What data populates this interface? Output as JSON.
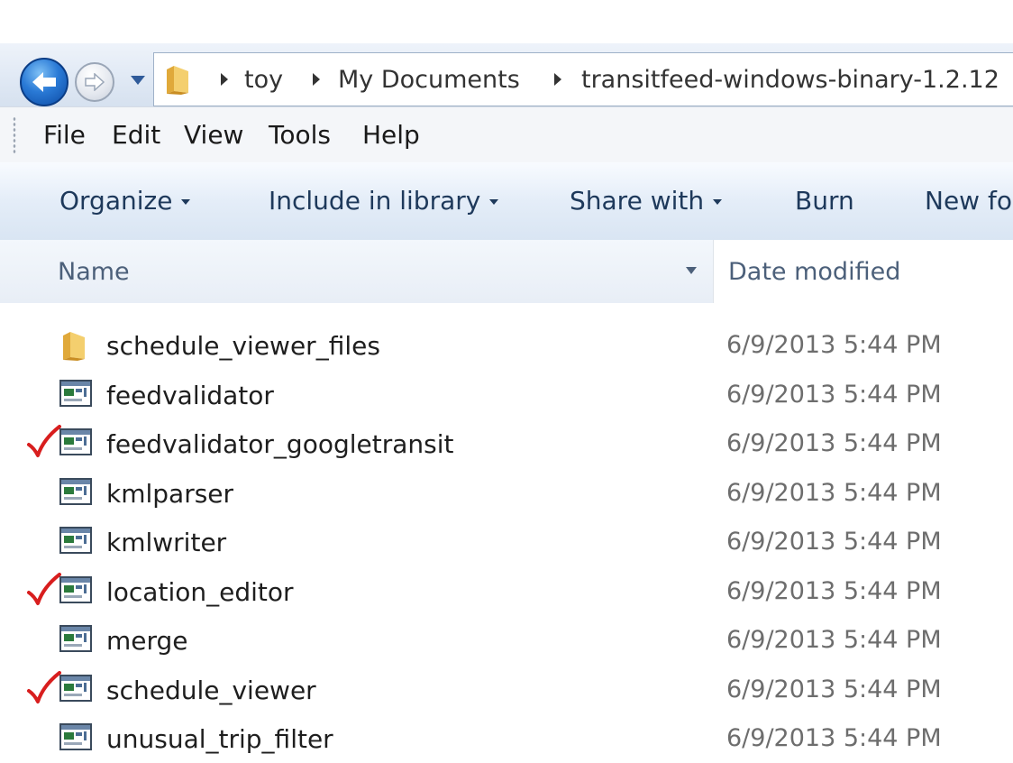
{
  "window": {
    "breadcrumb": [
      "toy",
      "My Documents",
      "transitfeed-windows-binary-1.2.12"
    ]
  },
  "menu": [
    "File",
    "Edit",
    "View",
    "Tools",
    "Help"
  ],
  "toolbar": {
    "organize": "Organize",
    "include_in_library": "Include in library",
    "share_with": "Share with",
    "burn": "Burn",
    "new_folder": "New fo"
  },
  "columns": {
    "name": "Name",
    "date_modified": "Date modified"
  },
  "files": [
    {
      "name": "schedule_viewer_files",
      "date": "6/9/2013 5:44 PM",
      "type": "folder",
      "checked": false
    },
    {
      "name": "feedvalidator",
      "date": "6/9/2013 5:44 PM",
      "type": "app",
      "checked": false
    },
    {
      "name": "feedvalidator_googletransit",
      "date": "6/9/2013 5:44 PM",
      "type": "app",
      "checked": true
    },
    {
      "name": "kmlparser",
      "date": "6/9/2013 5:44 PM",
      "type": "app",
      "checked": false
    },
    {
      "name": "kmlwriter",
      "date": "6/9/2013 5:44 PM",
      "type": "app",
      "checked": false
    },
    {
      "name": "location_editor",
      "date": "6/9/2013 5:44 PM",
      "type": "app",
      "checked": true
    },
    {
      "name": "merge",
      "date": "6/9/2013 5:44 PM",
      "type": "app",
      "checked": false
    },
    {
      "name": "schedule_viewer",
      "date": "6/9/2013 5:44 PM",
      "type": "app",
      "checked": true
    },
    {
      "name": "unusual_trip_filter",
      "date": "6/9/2013 5:44 PM",
      "type": "app",
      "checked": false
    }
  ],
  "colors": {
    "check_mark": "#d81e1e",
    "toolbar_text": "#1e395b",
    "header_text": "#4c607a",
    "date_text": "#6d6d6d"
  },
  "icons": {
    "back": "back-arrow-icon",
    "forward": "forward-arrow-icon",
    "folder": "folder-icon",
    "app": "application-window-icon",
    "check": "red-check-mark-icon"
  }
}
